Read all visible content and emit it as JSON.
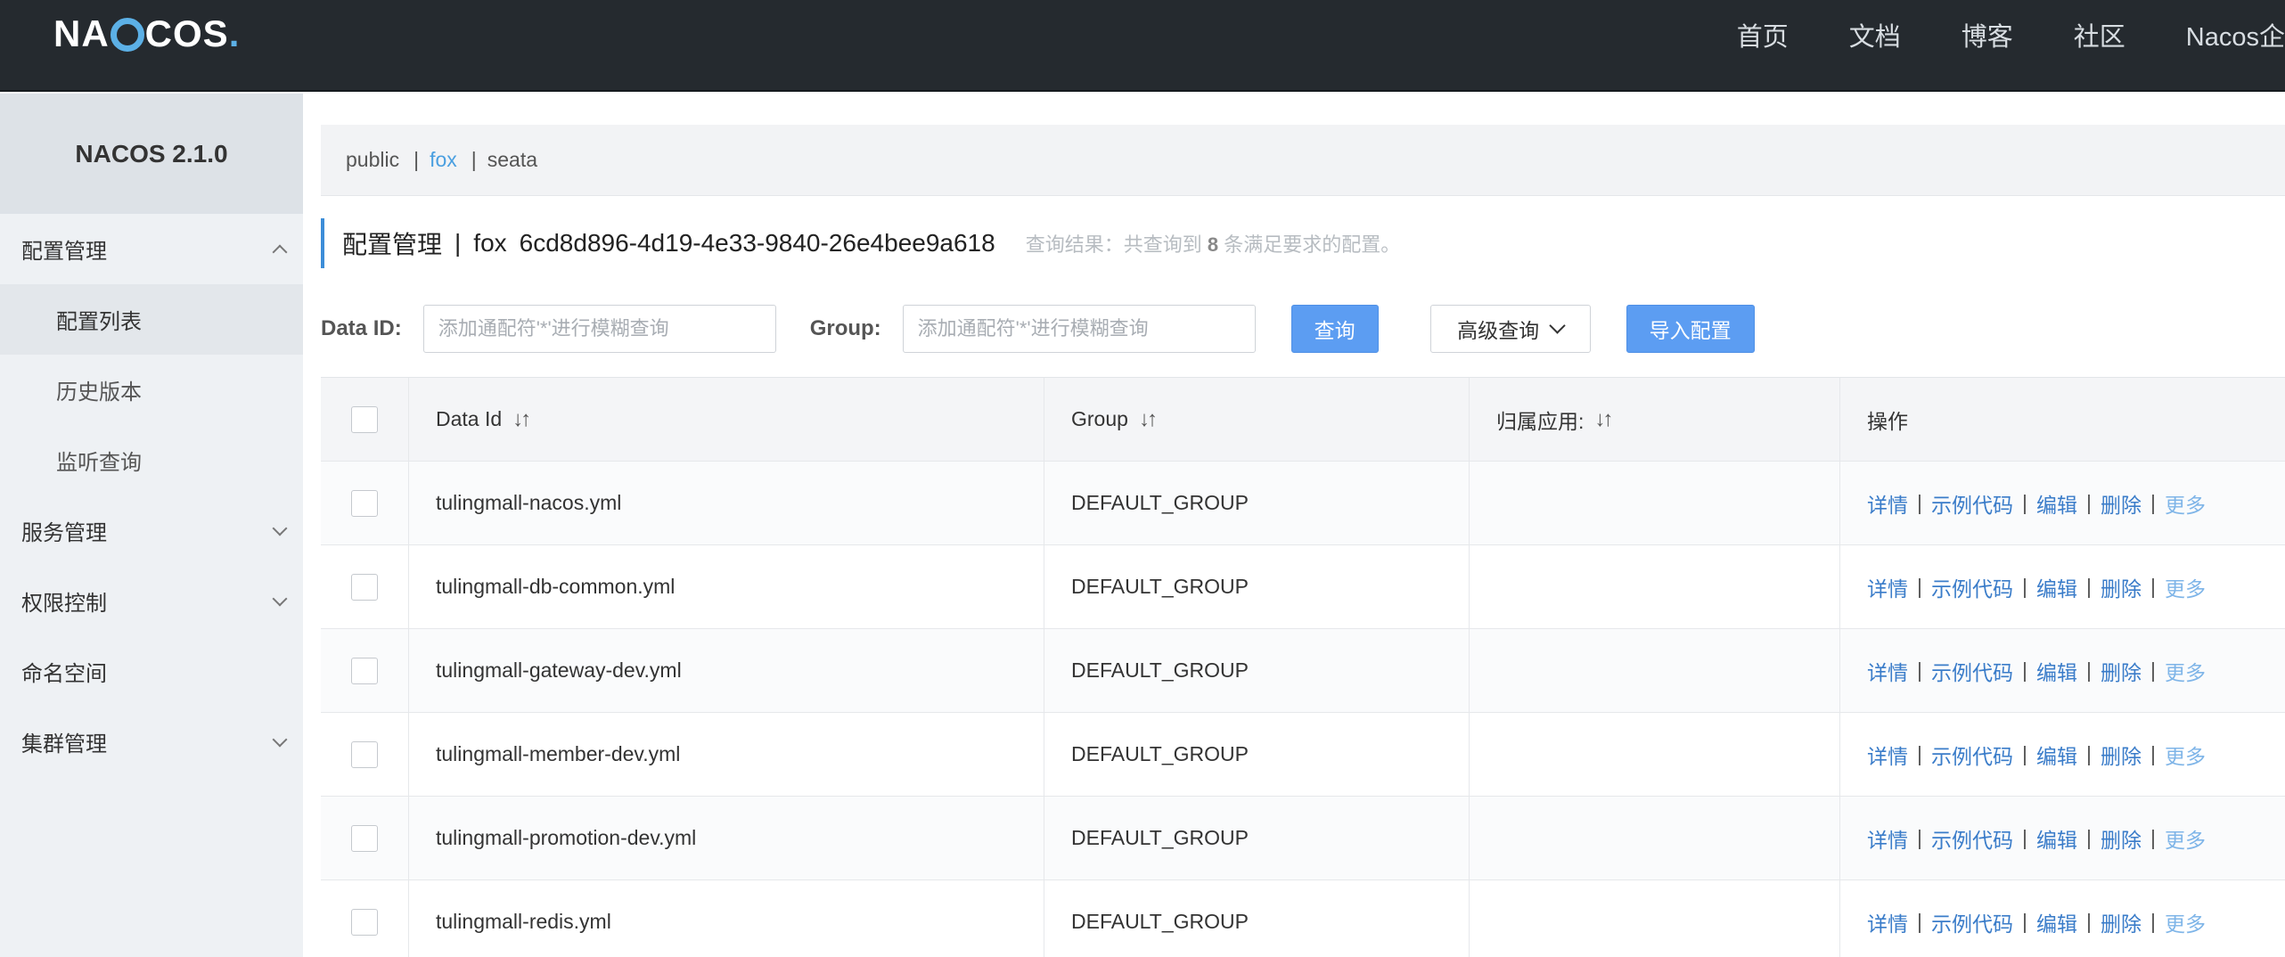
{
  "header": {
    "logo": {
      "part1": "NA",
      "part2": "COS",
      "dot": "."
    },
    "nav": [
      "首页",
      "文档",
      "博客",
      "社区",
      "Nacos企"
    ]
  },
  "sidebar": {
    "version": "NACOS 2.1.0",
    "items": [
      {
        "label": "配置管理",
        "icon": "chevron-up-icon"
      },
      {
        "label": "配置列表"
      },
      {
        "label": "历史版本"
      },
      {
        "label": "监听查询"
      },
      {
        "label": "服务管理",
        "icon": "chevron-down-icon"
      },
      {
        "label": "权限控制",
        "icon": "chevron-down-icon"
      },
      {
        "label": "命名空间"
      },
      {
        "label": "集群管理",
        "icon": "chevron-down-icon"
      }
    ]
  },
  "namespaces": {
    "items": [
      "public",
      "fox",
      "seata"
    ],
    "separator": "|",
    "active": "fox"
  },
  "title": {
    "section": "配置管理",
    "sep": "|",
    "namespace": "fox",
    "namespace_id": "6cd8d896-4d19-4e33-9840-26e4bee9a618",
    "hint_prefix": "查询结果：共查询到",
    "hint_count": "8",
    "hint_suffix": "条满足要求的配置。"
  },
  "search": {
    "data_id_label": "Data ID:",
    "data_id_placeholder": "添加通配符'*'进行模糊查询",
    "group_label": "Group:",
    "group_placeholder": "添加通配符'*'进行模糊查询",
    "query_button": "查询",
    "advanced_button": "高级查询",
    "import_button": "导入配置"
  },
  "table": {
    "columns": [
      "Data Id",
      "Group",
      "归属应用:",
      "操作"
    ],
    "sort_icon": "↓↑",
    "rows": [
      {
        "data_id": "tulingmall-nacos.yml",
        "group": "DEFAULT_GROUP",
        "app": ""
      },
      {
        "data_id": "tulingmall-db-common.yml",
        "group": "DEFAULT_GROUP",
        "app": ""
      },
      {
        "data_id": "tulingmall-gateway-dev.yml",
        "group": "DEFAULT_GROUP",
        "app": ""
      },
      {
        "data_id": "tulingmall-member-dev.yml",
        "group": "DEFAULT_GROUP",
        "app": ""
      },
      {
        "data_id": "tulingmall-promotion-dev.yml",
        "group": "DEFAULT_GROUP",
        "app": ""
      },
      {
        "data_id": "tulingmall-redis.yml",
        "group": "DEFAULT_GROUP",
        "app": ""
      }
    ],
    "actions": {
      "detail": "详情",
      "sample": "示例代码",
      "edit": "编辑",
      "delete": "删除",
      "more": "更多",
      "sep": "|"
    }
  },
  "colors": {
    "header_bg": "#252a2f",
    "accent": "#5c9df2",
    "link": "#3a7cc9",
    "sidebar_bg": "#eef1f4"
  }
}
